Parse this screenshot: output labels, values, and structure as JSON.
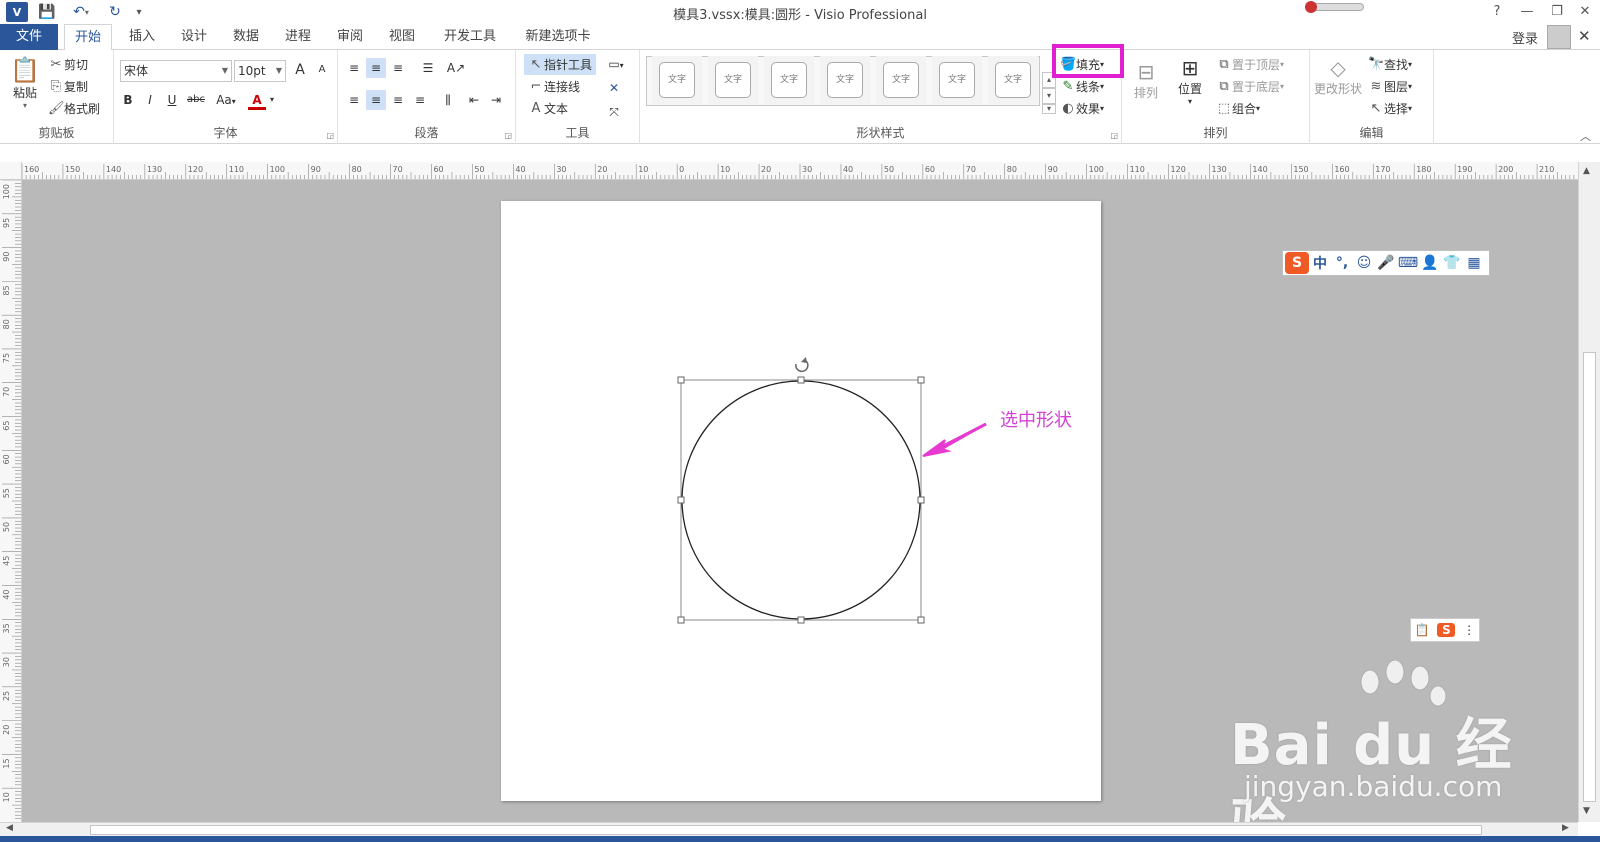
{
  "app": {
    "icon_label": "V",
    "title": "模具3.vssx:模具:圆形 - Visio Professional",
    "window_buttons": {
      "help": "?",
      "minimize": "—",
      "maximize": "❐",
      "close": "✕"
    }
  },
  "qat": {
    "save_icon": "💾",
    "undo_icon": "↶",
    "redo_icon": "↻",
    "more_icon": "▾"
  },
  "tabs": {
    "file": "文件",
    "items": [
      "开始",
      "插入",
      "设计",
      "数据",
      "进程",
      "审阅",
      "视图",
      "开发工具",
      "新建选项卡"
    ],
    "active": "开始",
    "login": "登录"
  },
  "ribbon": {
    "clipboard": {
      "label": "剪贴板",
      "paste": "粘贴",
      "cut": "剪切",
      "copy": "复制",
      "format_painter": "格式刷"
    },
    "font": {
      "label": "字体",
      "family": "宋体",
      "size": "10pt",
      "grow": "A",
      "shrink": "A",
      "bold": "B",
      "italic": "I",
      "underline": "U",
      "strike": "abc",
      "case": "Aa",
      "color": "A"
    },
    "paragraph": {
      "label": "段落"
    },
    "tools": {
      "label": "工具",
      "pointer": "指针工具",
      "connector": "连接线",
      "text": "文本"
    },
    "shape_styles": {
      "label": "形状样式",
      "style_text": "文字",
      "count": 7,
      "fill": "填充",
      "line": "线条",
      "effect": "效果"
    },
    "arrange": {
      "label": "排列",
      "align": "排列",
      "position": "位置",
      "bring_front": "置于顶层",
      "send_back": "置于底层",
      "group": "组合"
    },
    "editing": {
      "label": "编辑",
      "change_shape": "更改形状",
      "find": "查找",
      "layers": "图层",
      "select": "选择"
    }
  },
  "canvas": {
    "annotation": "选中形状",
    "ruler_h_labels": [
      "160",
      "150",
      "140",
      "130",
      "120",
      "110",
      "100",
      "90",
      "80",
      "70",
      "60",
      "50",
      "40",
      "30",
      "20",
      "10",
      "0",
      "10",
      "20",
      "30",
      "40",
      "50",
      "60",
      "70",
      "80",
      "90",
      "100",
      "110",
      "120",
      "130",
      "140",
      "150",
      "160",
      "170",
      "180",
      "190",
      "200",
      "210"
    ],
    "ruler_v_labels": [
      "100",
      "95",
      "90",
      "85",
      "80",
      "75",
      "70",
      "65",
      "60",
      "55",
      "50",
      "45",
      "40",
      "35",
      "30",
      "25",
      "20",
      "15",
      "10"
    ]
  },
  "ime": {
    "logo": "S",
    "items": [
      "中",
      "°,",
      "☺",
      "🎤",
      "⌨",
      "👤",
      "👕",
      "▦"
    ],
    "mini_logo": "S"
  },
  "watermark": {
    "brand": "Bai du 经验",
    "url": "jingyan.baidu.com"
  },
  "colors": {
    "accent": "#2b579a",
    "highlight": "#e020d0",
    "annotation": "#d43fd6",
    "canvas": "#b9b9b9"
  }
}
